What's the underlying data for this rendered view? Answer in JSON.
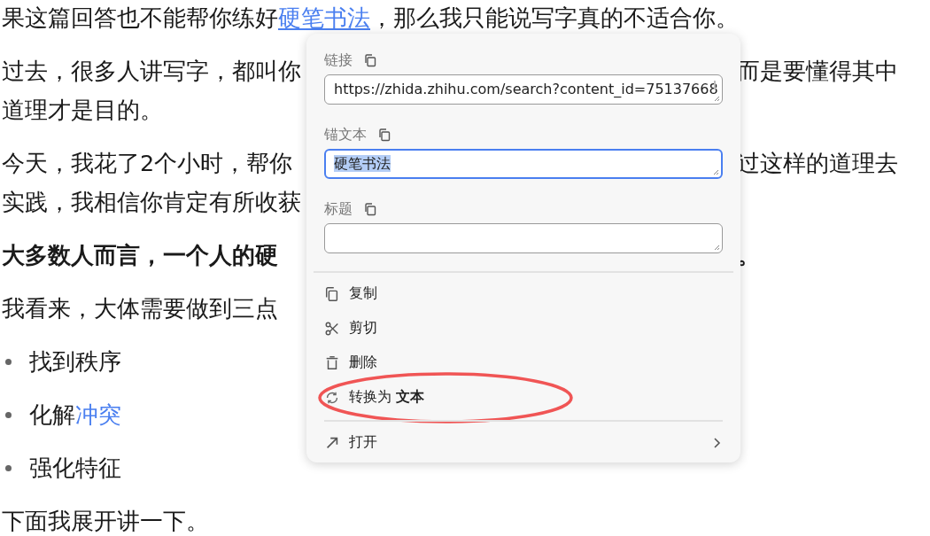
{
  "article": {
    "blocks": [
      {
        "kind": "paragraph",
        "bold": false,
        "lines": [
          {
            "left": [
              {
                "text": "果这篇回答也不能帮你练好",
                "link": false,
                "underlined": false
              },
              {
                "text": "硬笔书法",
                "link": true,
                "underlined": true
              },
              {
                "text": "，那么我只能说写字真的不适合你。",
                "link": false,
                "underlined": false
              }
            ]
          }
        ]
      },
      {
        "kind": "paragraph",
        "bold": false,
        "lines": [
          {
            "left": [
              {
                "text": "过去，很多人讲写字，都叫你",
                "link": false,
                "underlined": false
              }
            ],
            "right": "而是要懂得其中"
          },
          {
            "left": [
              {
                "text": "道理才是目的。",
                "link": false,
                "underlined": false
              }
            ]
          }
        ]
      },
      {
        "kind": "paragraph",
        "bold": false,
        "lines": [
          {
            "left": [
              {
                "text": "今天，我花了2个小时，帮你",
                "link": false,
                "underlined": false
              }
            ],
            "right": "过这样的道理去"
          },
          {
            "left": [
              {
                "text": "实践，我相信你肯定有所收获",
                "link": false,
                "underlined": false
              }
            ]
          }
        ]
      },
      {
        "kind": "paragraph",
        "bold": true,
        "lines": [
          {
            "left": [
              {
                "text": "大多数人而言，一个人的硬",
                "link": false,
                "underlined": false
              }
            ],
            "right": "。"
          }
        ]
      },
      {
        "kind": "paragraph",
        "bold": false,
        "lines": [
          {
            "left": [
              {
                "text": "我看来，大体需要做到三点",
                "link": false,
                "underlined": false
              }
            ]
          }
        ]
      },
      {
        "kind": "bullet",
        "segments": [
          {
            "text": "找到秩序",
            "link": false,
            "underlined": false
          }
        ]
      },
      {
        "kind": "bullet",
        "segments": [
          {
            "text": "化解",
            "link": false,
            "underlined": false
          },
          {
            "text": "冲突",
            "link": true,
            "underlined": false
          }
        ]
      },
      {
        "kind": "bullet",
        "segments": [
          {
            "text": "强化特征",
            "link": false,
            "underlined": false
          }
        ]
      },
      {
        "kind": "paragraph",
        "bold": false,
        "lines": [
          {
            "left": [
              {
                "text": "下面我展开讲一下。",
                "link": false,
                "underlined": false
              }
            ]
          }
        ]
      }
    ]
  },
  "popup": {
    "fields": [
      {
        "label": "链接",
        "value": "https://zhida.zhihu.com/search?content_id=75137668",
        "focused": false,
        "selected_text": false
      },
      {
        "label": "锚文本",
        "value": "硬笔书法",
        "focused": true,
        "selected_text": true
      },
      {
        "label": "标题",
        "focused": false
      }
    ],
    "menu": [
      {
        "kind": "copy",
        "label": "复制",
        "separated": false,
        "submenu": false,
        "circled": false
      },
      {
        "kind": "cut",
        "label": "剪切",
        "separated": false,
        "submenu": false,
        "circled": false
      },
      {
        "kind": "delete",
        "label": "删除",
        "separated": false,
        "submenu": false,
        "circled": false
      },
      {
        "kind": "convert",
        "label": "转换为 **文本**",
        "separated": false,
        "submenu": false,
        "circled": true
      },
      {
        "kind": "open",
        "label": "打开",
        "separated": true,
        "submenu": true,
        "circled": false
      }
    ]
  }
}
